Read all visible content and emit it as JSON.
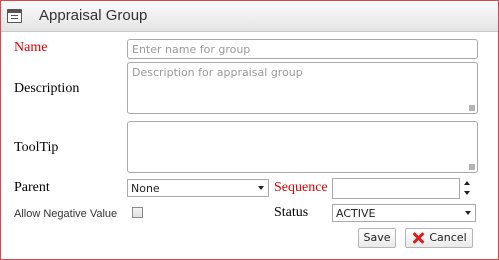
{
  "window": {
    "title": "Appraisal Group",
    "icon": "window-icon"
  },
  "form": {
    "name": {
      "label": "Name",
      "placeholder": "Enter name for group"
    },
    "description": {
      "label": "Description",
      "placeholder": "Description for appraisal group"
    },
    "tooltip": {
      "label": "ToolTip",
      "placeholder": ""
    },
    "parent": {
      "label": "Parent",
      "value": "None"
    },
    "sequence": {
      "label": "Sequence",
      "value": ""
    },
    "allow_negative": {
      "label": "Allow Negative Value",
      "checked": false
    },
    "status": {
      "label": "Status",
      "value": "ACTIVE"
    }
  },
  "buttons": {
    "save": "Save",
    "cancel": "Cancel"
  },
  "colors": {
    "required_label": "#e00000",
    "border": "#d84a4a",
    "cancel_icon": "#d81e1e"
  }
}
